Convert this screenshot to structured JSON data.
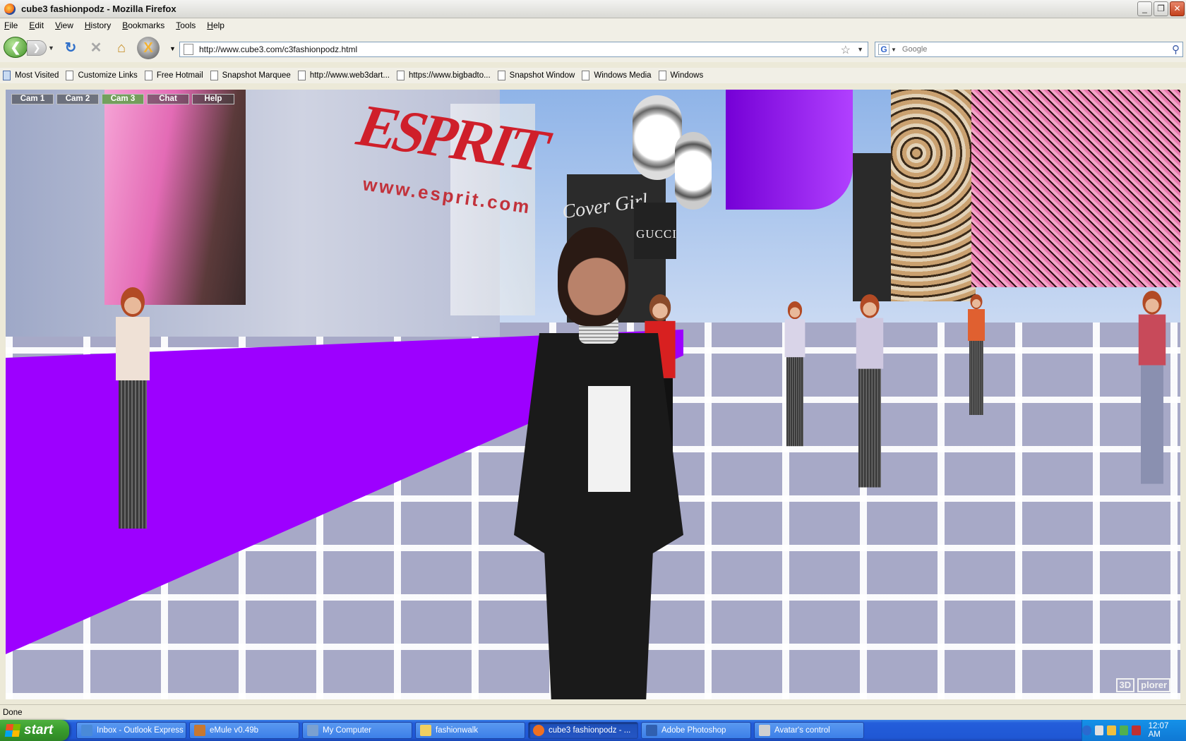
{
  "window": {
    "title": "cube3 fashionpodz - Mozilla Firefox",
    "controls": [
      "_",
      "❐",
      "✕"
    ]
  },
  "menubar": [
    "File",
    "Edit",
    "View",
    "History",
    "Bookmarks",
    "Tools",
    "Help"
  ],
  "navbar": {
    "url": "http://www.cube3.com/c3fashionpodz.html",
    "search_placeholder": "Google",
    "icons": [
      "back-icon",
      "forward-icon",
      "reload-icon",
      "stop-icon",
      "home-icon",
      "xplorer-icon",
      "star-icon",
      "search-icon"
    ]
  },
  "bookmarks": [
    {
      "label": "Most Visited",
      "type": "folder"
    },
    {
      "label": "Customize Links",
      "type": "page"
    },
    {
      "label": "Free Hotmail",
      "type": "page"
    },
    {
      "label": "Snapshot Marquee",
      "type": "page"
    },
    {
      "label": "http://www.web3dart...",
      "type": "page"
    },
    {
      "label": "https://www.bigbadto...",
      "type": "page"
    },
    {
      "label": "Snapshot Window",
      "type": "page"
    },
    {
      "label": "Windows Media",
      "type": "page"
    },
    {
      "label": "Windows",
      "type": "page"
    }
  ],
  "scene": {
    "cam_menu": [
      {
        "label": "Cam 1",
        "active": false
      },
      {
        "label": "Cam 2",
        "active": false
      },
      {
        "label": "Cam 3",
        "active": true
      },
      {
        "label": "Chat",
        "active": false
      },
      {
        "label": "Help",
        "active": false
      }
    ],
    "signage": {
      "esprit": "ESPRIT",
      "esprit_url": "www.esprit.com",
      "cover_girl": "Cover Girl",
      "gucci": "GUCCI"
    },
    "logo": [
      "3D",
      "plorer"
    ],
    "colors": {
      "floor": "#a7a9c7",
      "accent_purple": "#9d00ff",
      "cam_active": "#66a050"
    }
  },
  "statusbar": {
    "text": "Done"
  },
  "taskbar": {
    "start_label": "start",
    "tasks": [
      {
        "label": "Inbox - Outlook Express",
        "color": "#4a8ad8",
        "active": false
      },
      {
        "label": "eMule v0.49b",
        "color": "#c87830",
        "active": false
      },
      {
        "label": "My Computer",
        "color": "#7aa0d0",
        "active": false
      },
      {
        "label": "fashionwalk",
        "color": "#f0d060",
        "active": false
      },
      {
        "label": "cube3 fashionpodz - ...",
        "color": "#f07020",
        "active": true
      },
      {
        "label": "Adobe Photoshop",
        "color": "#3060b0",
        "active": false
      },
      {
        "label": "Avatar's control",
        "color": "#d0d0d0",
        "active": false
      }
    ],
    "clock": "12:07 AM"
  }
}
